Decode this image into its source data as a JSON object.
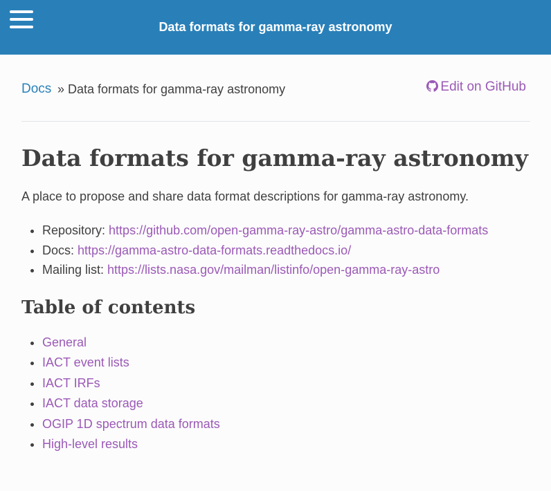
{
  "header": {
    "menu_icon": "hamburger-menu-icon",
    "title": "Data formats for gamma-ray astronomy"
  },
  "breadcrumb": {
    "docs_label": "Docs",
    "separator": "»",
    "current": "Data formats for gamma-ray astronomy",
    "edit_label": "Edit on GitHub",
    "edit_icon": "github-icon"
  },
  "page": {
    "title": "Data formats for gamma-ray astronomy",
    "intro": "A place to propose and share data format descriptions for gamma-ray astronomy.",
    "links": [
      {
        "label": "Repository: ",
        "url": "https://github.com/open-gamma-ray-astro/gamma-astro-data-formats"
      },
      {
        "label": "Docs: ",
        "url": "https://gamma-astro-data-formats.readthedocs.io/"
      },
      {
        "label": "Mailing list: ",
        "url": "https://lists.nasa.gov/mailman/listinfo/open-gamma-ray-astro"
      }
    ],
    "toc_title": "Table of contents",
    "toc": [
      "General",
      "IACT event lists",
      "IACT IRFs",
      "IACT data storage",
      "OGIP 1D spectrum data formats",
      "High-level results"
    ]
  },
  "colors": {
    "header_bg": "#2980b9",
    "link": "#2980b9",
    "visited_link": "#9b59b6",
    "text": "#404040"
  }
}
